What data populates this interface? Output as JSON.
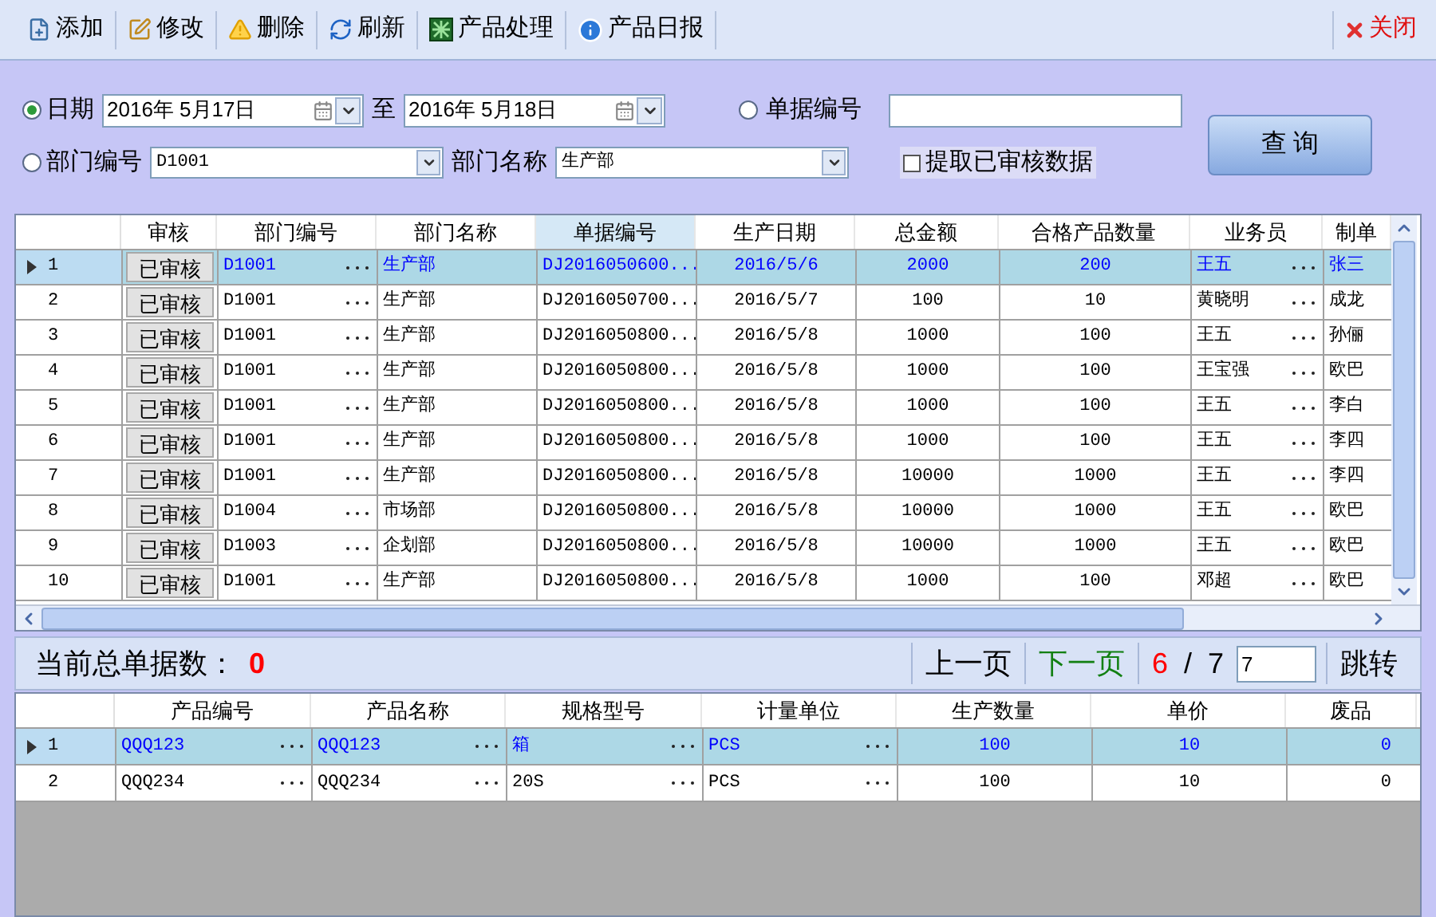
{
  "toolbar": {
    "items": [
      {
        "label": "添加",
        "kind": "add"
      },
      {
        "label": "修改",
        "kind": "edit"
      },
      {
        "label": "删除",
        "kind": "delete"
      },
      {
        "label": "刷新",
        "kind": "refresh"
      },
      {
        "label": "产品处理",
        "kind": "process"
      },
      {
        "label": "产品日报",
        "kind": "report"
      }
    ],
    "close": {
      "label": "关闭"
    }
  },
  "filter": {
    "date": {
      "label": "日期",
      "selected": true,
      "from": "2016年  5月17日",
      "to_label": "至",
      "to": "2016年  5月18日"
    },
    "doc_no": {
      "label": "单据编号",
      "selected": false
    },
    "dept_code": {
      "label": "部门编号",
      "selected": false,
      "value": "D1001"
    },
    "dept_name": {
      "label": "部门名称",
      "value": "生产部"
    },
    "audited": {
      "label": "提取已审核数据",
      "checked": false
    },
    "query_button": "查 询"
  },
  "orders": {
    "columns": [
      {
        "label": "审核",
        "kind": "button",
        "highlighted": false
      },
      {
        "label": "部门编号",
        "kind": "lookup",
        "highlighted": false
      },
      {
        "label": "部门名称",
        "kind": "text",
        "highlighted": false
      },
      {
        "label": "单据编号",
        "kind": "text",
        "highlighted": true
      },
      {
        "label": "生产日期",
        "kind": "text",
        "highlighted": false
      },
      {
        "label": "总金额",
        "kind": "text",
        "highlighted": false
      },
      {
        "label": "合格产品数量",
        "kind": "text",
        "highlighted": false
      },
      {
        "label": "业务员",
        "kind": "lookup",
        "highlighted": false
      },
      {
        "label": "制单",
        "kind": "text",
        "highlighted": false
      }
    ],
    "rows": [
      {
        "number": "1",
        "selected": true,
        "cells": [
          "已审核",
          "D1001",
          "生产部",
          "DJ2016050600...",
          "2016/5/6",
          "2000",
          "200",
          "王五",
          "张三"
        ]
      },
      {
        "number": "2",
        "selected": false,
        "cells": [
          "已审核",
          "D1001",
          "生产部",
          "DJ2016050700...",
          "2016/5/7",
          "100",
          "10",
          "黄晓明",
          "成龙"
        ]
      },
      {
        "number": "3",
        "selected": false,
        "cells": [
          "已审核",
          "D1001",
          "生产部",
          "DJ2016050800...",
          "2016/5/8",
          "1000",
          "100",
          "王五",
          "孙俪"
        ]
      },
      {
        "number": "4",
        "selected": false,
        "cells": [
          "已审核",
          "D1001",
          "生产部",
          "DJ2016050800...",
          "2016/5/8",
          "1000",
          "100",
          "王宝强",
          "欧巴"
        ]
      },
      {
        "number": "5",
        "selected": false,
        "cells": [
          "已审核",
          "D1001",
          "生产部",
          "DJ2016050800...",
          "2016/5/8",
          "1000",
          "100",
          "王五",
          "李白"
        ]
      },
      {
        "number": "6",
        "selected": false,
        "cells": [
          "已审核",
          "D1001",
          "生产部",
          "DJ2016050800...",
          "2016/5/8",
          "1000",
          "100",
          "王五",
          "李四"
        ]
      },
      {
        "number": "7",
        "selected": false,
        "cells": [
          "已审核",
          "D1001",
          "生产部",
          "DJ2016050800...",
          "2016/5/8",
          "10000",
          "1000",
          "王五",
          "李四"
        ]
      },
      {
        "number": "8",
        "selected": false,
        "cells": [
          "已审核",
          "D1004",
          "市场部",
          "DJ2016050800...",
          "2016/5/8",
          "10000",
          "1000",
          "王五",
          "欧巴"
        ]
      },
      {
        "number": "9",
        "selected": false,
        "cells": [
          "已审核",
          "D1003",
          "企划部",
          "DJ2016050800...",
          "2016/5/8",
          "10000",
          "1000",
          "王五",
          "欧巴"
        ]
      },
      {
        "number": "10",
        "selected": false,
        "cells": [
          "已审核",
          "D1001",
          "生产部",
          "DJ2016050800...",
          "2016/5/8",
          "1000",
          "100",
          "邓超",
          "欧巴"
        ]
      }
    ]
  },
  "pager": {
    "total_label": "当前总单据数：",
    "total": "0",
    "prev": "上一页",
    "next": "下一页",
    "page": "6",
    "slash": "/",
    "pages": "7",
    "jump_value": "7",
    "jump": "跳转"
  },
  "products": {
    "columns": [
      {
        "label": "产品编号",
        "kind": "lookup",
        "highlighted": false
      },
      {
        "label": "产品名称",
        "kind": "lookup",
        "highlighted": false
      },
      {
        "label": "规格型号",
        "kind": "lookup",
        "highlighted": false
      },
      {
        "label": "计量单位",
        "kind": "lookup",
        "highlighted": false
      },
      {
        "label": "生产数量",
        "kind": "text",
        "highlighted": false
      },
      {
        "label": "单价",
        "kind": "text",
        "highlighted": false
      },
      {
        "label": "废品",
        "kind": "text",
        "highlighted": false
      }
    ],
    "rows": [
      {
        "number": "1",
        "selected": true,
        "cells": [
          "QQQ123",
          "QQQ123",
          "箱",
          "PCS",
          "100",
          "10",
          "0"
        ]
      },
      {
        "number": "2",
        "selected": false,
        "cells": [
          "QQQ234",
          "QQQ234",
          "20S",
          "PCS",
          "100",
          "10",
          "0"
        ]
      }
    ]
  }
}
